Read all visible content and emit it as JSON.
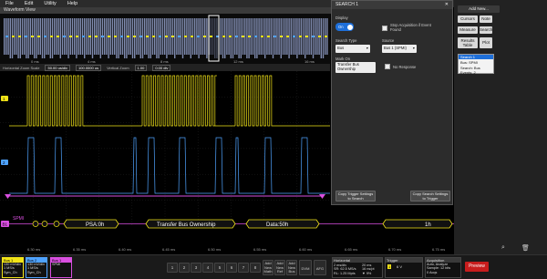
{
  "menu": [
    "File",
    "Edit",
    "Utility",
    "Help"
  ],
  "waveform_view_title": "Waveform View",
  "zoom": {
    "h_label": "Horizontal Zoom Scale",
    "h_value": "50.00 us/div",
    "h_pos": "100.0000 us",
    "v_label": "Vertical Zoom",
    "v_value": "1.00",
    "v_pos": "0.00 div"
  },
  "overview_ticks": [
    "0 ms",
    "4 ms",
    "8 ms",
    "12 ms",
    "16 ms"
  ],
  "channels": [
    {
      "label": "1",
      "color": "#f2e418"
    },
    {
      "label": "2",
      "color": "#4fa3ff"
    }
  ],
  "decode": {
    "bus_label": "B1",
    "bus_name": "SPMI",
    "segments": [
      "PSA:0h",
      "Transfer Bus Ownership",
      "Data:50h",
      "1h"
    ]
  },
  "time_ticks": [
    "6.30 ms",
    "6.35 ms",
    "6.40 ms",
    "6.45 ms",
    "6.50 ms",
    "6.55 ms",
    "6.60 ms",
    "6.65 ms",
    "6.70 ms",
    "6.75 ms"
  ],
  "search_panel": {
    "title": "SEARCH 1",
    "display_label": "Display",
    "display_value": "On",
    "stop_acq_label": "Stop Acquisition if Event Found",
    "search_type_label": "Search Type",
    "search_type_value": "Bus",
    "source_label": "Source",
    "source_value": "Bus 1 (SPMI)",
    "mark_on_label": "Mark On",
    "mark_on_value": "Transfer Bus Ownership",
    "no_response_label": "No Response",
    "copy_trigger_btn": "Copy Trigger Settings to Search",
    "copy_search_btn": "Copy Search Settings to Trigger",
    "close_icon": "close-icon"
  },
  "right_panel": {
    "add_new": "Add New...",
    "buttons": [
      "Cursors",
      "Note",
      "Measure",
      "Search",
      "Results Table",
      "Plot"
    ],
    "search_result_title": "Search 1",
    "search_result_lines": [
      "Bus: SPMI",
      "Search: Bus",
      "Events: 2"
    ]
  },
  "bottom": {
    "ch1": {
      "name": "Bus 1",
      "lines": [
        "130 mV/div",
        "1 MS/s",
        "Sym_Ch"
      ]
    },
    "ch2": {
      "name": "Bus 2",
      "lines": [
        "130 mV/div",
        "1 MS/s",
        "Sym_Ch"
      ]
    },
    "bus1": {
      "name": "Bus 1",
      "lines": [
        "SPMI"
      ]
    },
    "channel_buttons": [
      "1",
      "2",
      "3",
      "4",
      "5",
      "6",
      "7",
      "8"
    ],
    "add_buttons": [
      "Add New Math",
      "Add New Ref",
      "Add New Bus"
    ],
    "dvm": "DVM",
    "afg": "AFG",
    "horizontal": {
      "title": "Horizontal",
      "lines": [
        "2 ms/div",
        "SR: 62.5 MS/s",
        "RL: 1.25 Mpts"
      ],
      "lines2": [
        "20 ms",
        "16 ns/pt",
        "▼ 9%"
      ]
    },
    "trigger": {
      "title": "Trigger",
      "lines": [
        "1",
        "6 V"
      ]
    },
    "acquisition": {
      "title": "Acquisition",
      "lines": [
        "Auto,  Analyze",
        "Sample: 12 bits",
        "0 Acqs"
      ]
    },
    "preview": "Preview"
  },
  "colors": {
    "ch1": "#f2e418",
    "ch2": "#4fa3ff",
    "bus": "#d94fe0",
    "accent": "#1e6fd9"
  }
}
